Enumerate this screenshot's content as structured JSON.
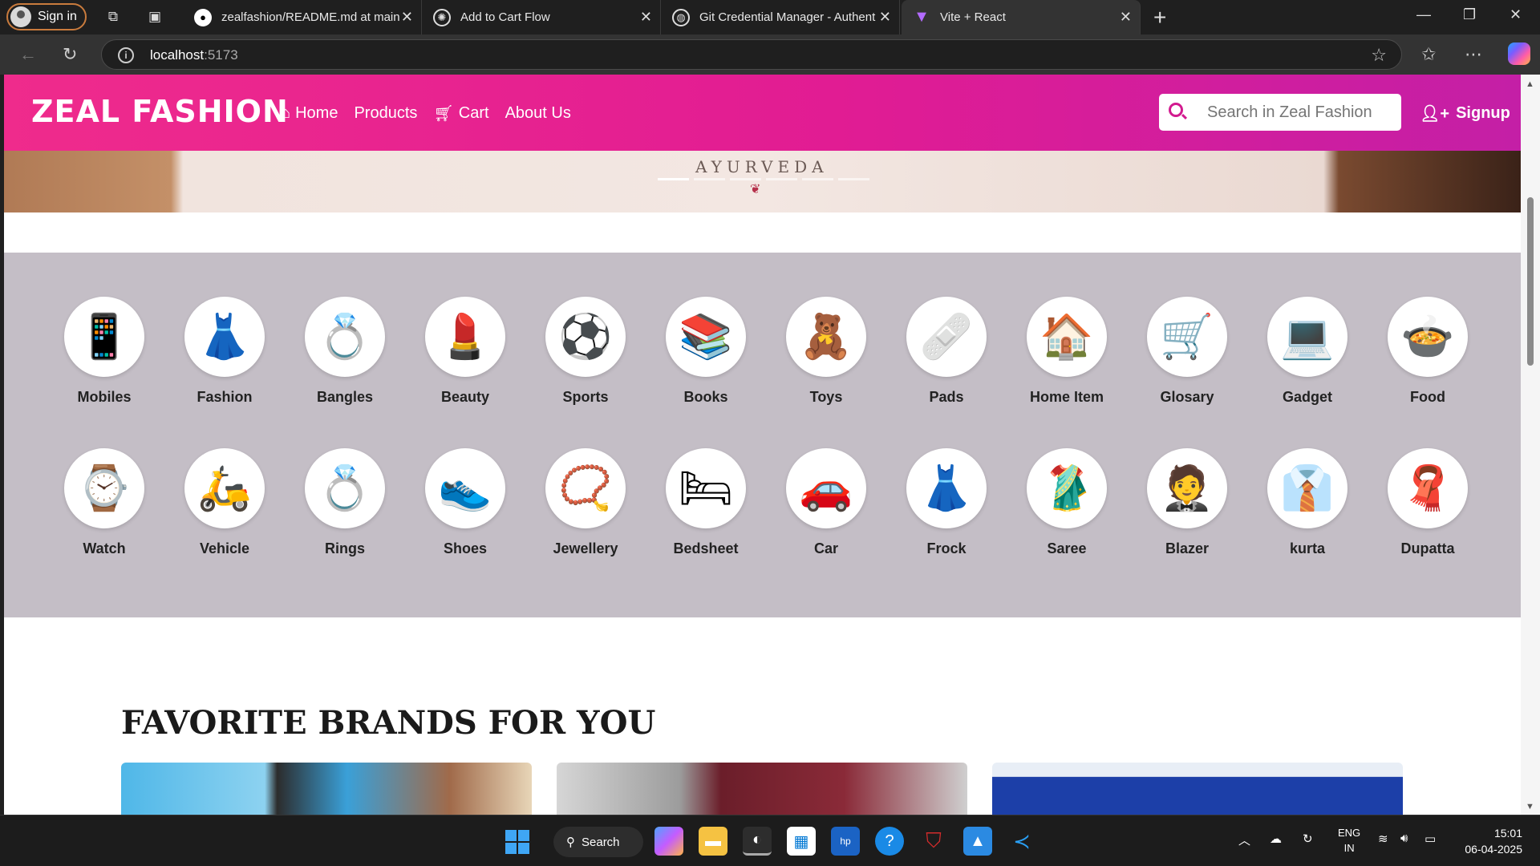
{
  "browser": {
    "signin_label": "Sign in",
    "tabs": [
      {
        "title": "zealfashion/README.md at main",
        "icon": "github-icon"
      },
      {
        "title": "Add to Cart Flow",
        "icon": "chatgpt-icon"
      },
      {
        "title": "Git Credential Manager - Authent",
        "icon": "globe-icon"
      },
      {
        "title": "Vite + React",
        "icon": "vite-icon"
      }
    ],
    "url_host": "localhost",
    "url_port": ":5173"
  },
  "site": {
    "brand": "ZEAL FASHION",
    "nav": [
      {
        "label": "Home",
        "icon": "home-icon"
      },
      {
        "label": "Products"
      },
      {
        "label": "Cart",
        "icon": "cart-icon"
      },
      {
        "label": "About Us"
      }
    ],
    "search_placeholder": "Search in Zeal Fashion",
    "signup_label": "Signup",
    "accent": "#e11c93",
    "hero": {
      "brand_text": "AYURVEDA",
      "slides": 6,
      "active_slide": 1
    },
    "categories": [
      {
        "label": "Mobiles",
        "icon": "📱"
      },
      {
        "label": "Fashion",
        "icon": "👗"
      },
      {
        "label": "Bangles",
        "icon": "💍"
      },
      {
        "label": "Beauty",
        "icon": "💄"
      },
      {
        "label": "Sports",
        "icon": "⚽"
      },
      {
        "label": "Books",
        "icon": "📚"
      },
      {
        "label": "Toys",
        "icon": "🧸"
      },
      {
        "label": "Pads",
        "icon": "🩹"
      },
      {
        "label": "Home Item",
        "icon": "🏠"
      },
      {
        "label": "Glosary",
        "icon": "🛒"
      },
      {
        "label": "Gadget",
        "icon": "💻"
      },
      {
        "label": "Food",
        "icon": "🍲"
      },
      {
        "label": "Watch",
        "icon": "⌚"
      },
      {
        "label": "Vehicle",
        "icon": "🛵"
      },
      {
        "label": "Rings",
        "icon": "💍"
      },
      {
        "label": "Shoes",
        "icon": "👟"
      },
      {
        "label": "Jewellery",
        "icon": "📿"
      },
      {
        "label": "Bedsheet",
        "icon": "🛏"
      },
      {
        "label": "Car",
        "icon": "🚗"
      },
      {
        "label": "Frock",
        "icon": "👗"
      },
      {
        "label": "Saree",
        "icon": "🥻"
      },
      {
        "label": "Blazer",
        "icon": "🤵"
      },
      {
        "label": "kurta",
        "icon": "👔"
      },
      {
        "label": "Dupatta",
        "icon": "🧣"
      }
    ],
    "brands_heading": "FAVORITE BRANDS FOR YOU"
  },
  "taskbar": {
    "search_label": "Search",
    "lang_line1": "ENG",
    "lang_line2": "IN",
    "time": "15:01",
    "date": "06-04-2025"
  }
}
